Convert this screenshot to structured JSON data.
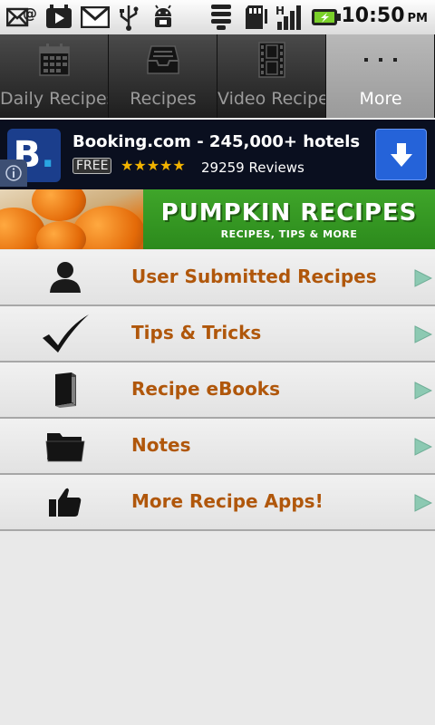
{
  "status_bar": {
    "time": "10:50",
    "ampm": "PM",
    "icons": [
      "email-icon",
      "youtube-icon",
      "gmail-icon",
      "usb-icon",
      "android-debug-icon",
      "wifi-icon",
      "sd-card-icon",
      "signal-icon",
      "battery-charging-icon"
    ]
  },
  "tabs": [
    {
      "label": "Daily Recipes",
      "icon": "calendar-icon",
      "active": false
    },
    {
      "label": "Recipes",
      "icon": "inbox-icon",
      "active": false
    },
    {
      "label": "Video Recipe",
      "icon": "film-icon",
      "active": false
    },
    {
      "label": "More",
      "icon": "more-dots-icon",
      "active": true
    }
  ],
  "ad": {
    "logo_letter": "B",
    "logo_dot": ".",
    "title": "Booking.com - 245,000+ hotels",
    "badge": "FREE",
    "rating": 4.5,
    "stars": "★★★★★",
    "reviews": "29259 Reviews"
  },
  "promo": {
    "title": "PUMPKIN RECIPES",
    "subtitle": "RECIPES, TIPS & MORE"
  },
  "menu": [
    {
      "label": "User Submitted Recipes",
      "icon": "user-icon"
    },
    {
      "label": "Tips & Tricks",
      "icon": "checkmark-icon"
    },
    {
      "label": "Recipe eBooks",
      "icon": "book-icon"
    },
    {
      "label": "Notes",
      "icon": "folder-icon"
    },
    {
      "label": "More Recipe Apps!",
      "icon": "thumbs-up-icon"
    }
  ],
  "colors": {
    "menu_text": "#b0570b",
    "arrow": "#8cc9b2",
    "promo_green": "#35981f",
    "ad_button": "#2563d9"
  }
}
